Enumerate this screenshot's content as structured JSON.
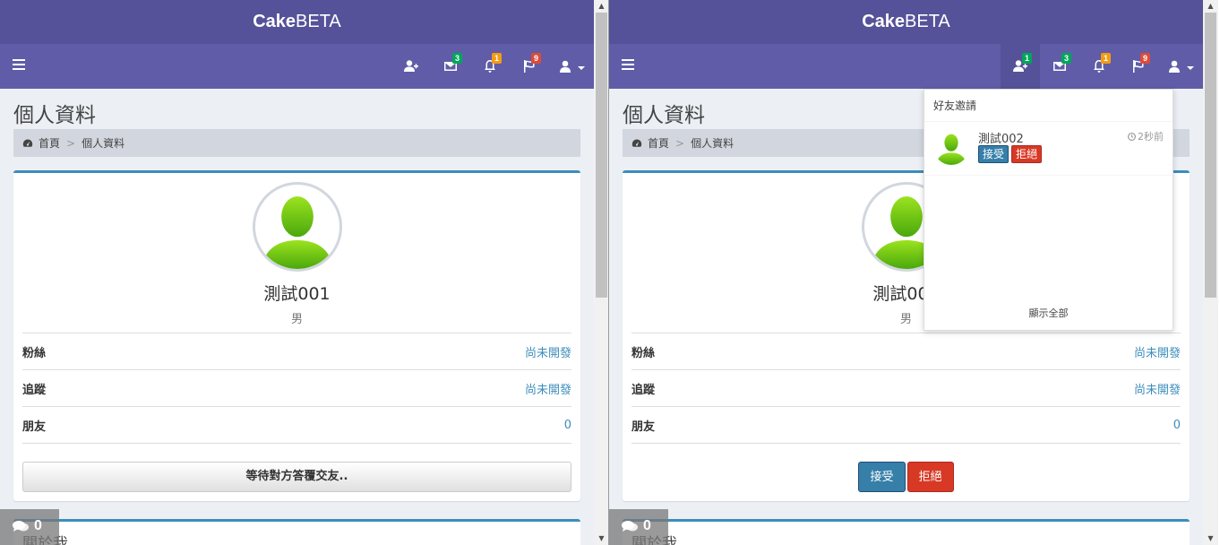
{
  "brand": {
    "bold": "Cake",
    "rest": "BETA"
  },
  "badges": {
    "friend_requests": "1",
    "messages": "3",
    "notifications": "1",
    "flags": "9"
  },
  "page": {
    "title": "個人資料"
  },
  "breadcrumb": {
    "home": "首頁",
    "sep": ">",
    "current": "個人資料"
  },
  "profile": {
    "username": "測試001",
    "gender": "男",
    "stats": [
      {
        "label": "粉絲",
        "value": "尚未開發"
      },
      {
        "label": "追蹤",
        "value": "尚未開發"
      },
      {
        "label": "朋友",
        "value": "0"
      }
    ],
    "waiting_button": "等待對方答覆交友..",
    "accept_button": "接受",
    "reject_button": "拒絕"
  },
  "about": {
    "title": "關於我"
  },
  "chat": {
    "count": "0"
  },
  "dropdown": {
    "header": "好友邀請",
    "items": [
      {
        "name": "測試002",
        "time": "2秒前",
        "accept": "接受",
        "reject": "拒絕"
      }
    ],
    "footer": "顯示全部"
  },
  "colors": {
    "header": "#555299",
    "navbar": "#605ca8",
    "accent": "#3c8dbc",
    "green": "#00a65a",
    "yellow": "#f39c12",
    "red": "#dd4b39"
  },
  "icons": [
    "bars-icon",
    "user-plus-icon",
    "envelope-icon",
    "bell-icon",
    "flag-icon",
    "user-icon",
    "dashboard-icon",
    "clock-icon",
    "comments-icon"
  ]
}
